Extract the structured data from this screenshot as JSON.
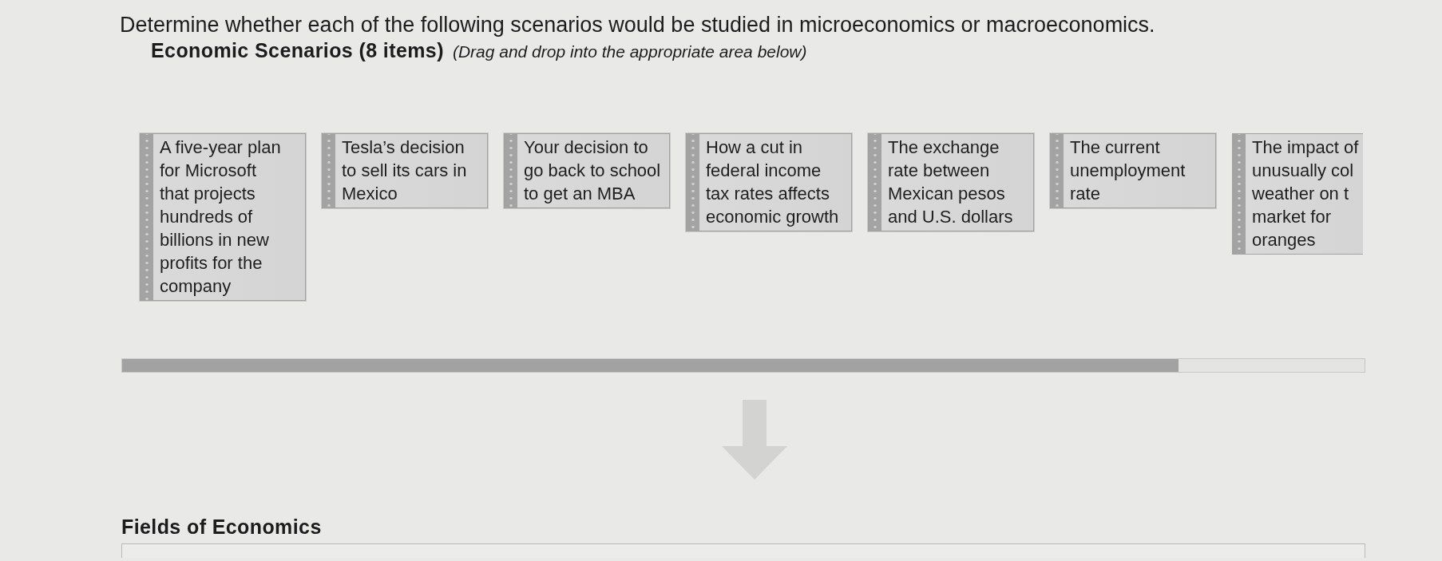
{
  "instruction": "Determine whether each of the following scenarios would be studied in microeconomics or macroeconomics.",
  "source_panel": {
    "title": "Economic Scenarios (8 items)",
    "hint": "(Drag and drop into the appropriate area below)",
    "items": [
      {
        "text": "A five-year plan\nfor Microsoft\nthat projects\nhundreds of\nbillions in new\nprofits for the\ncompany",
        "clipped": false
      },
      {
        "text": "Tesla’s decision\nto sell its cars in\nMexico",
        "clipped": false
      },
      {
        "text": "Your decision to\ngo back to school\nto get an MBA",
        "clipped": false
      },
      {
        "text": "How a cut in\nfederal income\ntax rates affects\neconomic growth",
        "clipped": false
      },
      {
        "text": "The exchange\nrate between\nMexican pesos\nand U.S. dollars",
        "clipped": false
      },
      {
        "text": "The current\nunemployment\nrate",
        "clipped": false
      },
      {
        "text": "The impact of\nunusually col\nweather on t\nmarket for\noranges",
        "clipped": true
      }
    ]
  },
  "target_panel": {
    "title": "Fields of Economics"
  }
}
